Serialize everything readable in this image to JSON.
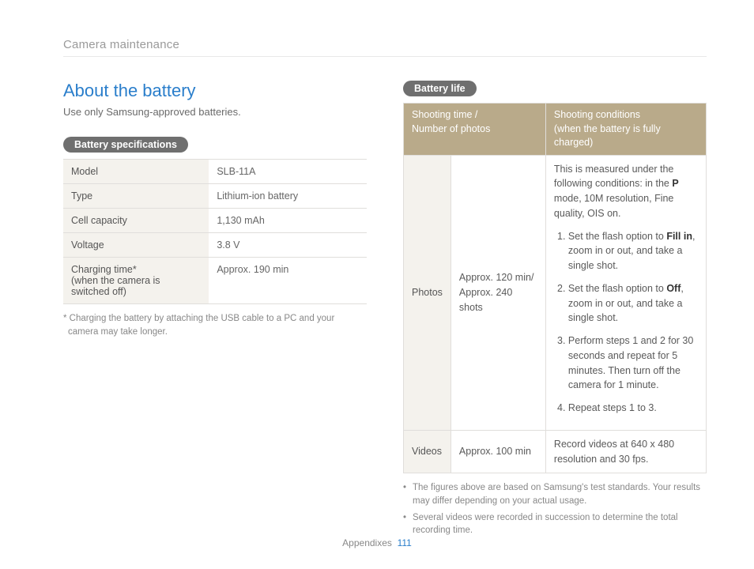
{
  "breadcrumb": "Camera maintenance",
  "left": {
    "title": "About the battery",
    "intro": "Use only Samsung-approved batteries.",
    "spec_label": "Battery specifications",
    "rows": [
      {
        "label": "Model",
        "value": "SLB-11A"
      },
      {
        "label": "Type",
        "value": "Lithium-ion battery"
      },
      {
        "label": "Cell capacity",
        "value": "1,130 mAh"
      },
      {
        "label": "Voltage",
        "value": "3.8 V"
      },
      {
        "label": "Charging time*\n(when the camera is switched off)",
        "value": "Approx. 190 min"
      }
    ],
    "footnote": "* Charging the battery by attaching the USB cable to a PC and your camera may take longer."
  },
  "right": {
    "life_label": "Battery life",
    "head_col1_a": "Shooting time /",
    "head_col1_b": "Number of photos",
    "head_col2_a": "Shooting conditions",
    "head_col2_b": "(when the battery is fully charged)",
    "photos_row": "Photos",
    "photos_time_a": "Approx. 120 min/",
    "photos_time_b": "Approx. 240 shots",
    "cond_intro_pre": "This is measured under the following conditions: in the ",
    "cond_intro_mode": "P",
    "cond_intro_post": " mode, 10M resolution, Fine quality, OIS on.",
    "step1_pre": "Set the flash option to ",
    "step1_bold": "Fill in",
    "step1_post": ", zoom in or out, and take a single shot.",
    "step2_pre": "Set the flash option to ",
    "step2_bold": "Off",
    "step2_post": ", zoom in or out, and take a single shot.",
    "step3": "Perform steps 1 and 2 for 30 seconds and repeat for 5 minutes. Then turn off the camera for 1 minute.",
    "step4": "Repeat steps 1 to 3.",
    "videos_row": "Videos",
    "videos_time": "Approx. 100 min",
    "videos_cond": "Record videos at 640 x 480 resolution and 30 fps.",
    "note1": "The figures above are based on Samsung's test standards. Your results may differ depending on your actual usage.",
    "note2": "Several videos were recorded in succession to determine the total recording time."
  },
  "footer": {
    "section": "Appendixes",
    "page": "111"
  }
}
